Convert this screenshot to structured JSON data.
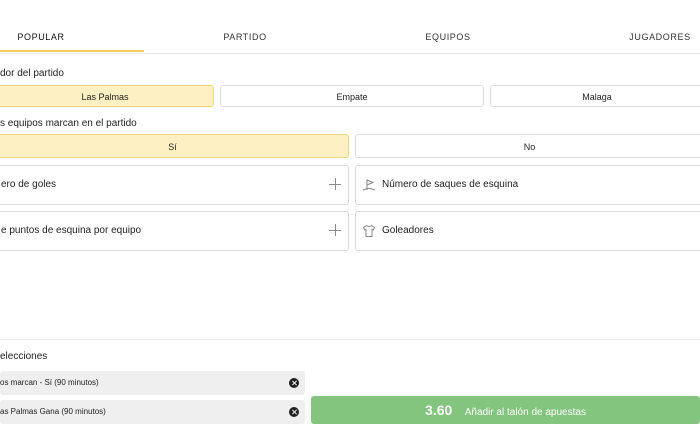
{
  "tabs": [
    {
      "label": "POPULAR",
      "active": true
    },
    {
      "label": "PARTIDO",
      "active": false
    },
    {
      "label": "EQUIPOS",
      "active": false
    },
    {
      "label": "JUGADORES",
      "active": false
    }
  ],
  "markets": {
    "winner": {
      "title": "dor del partido",
      "options": [
        {
          "label": "Las Palmas",
          "selected": true
        },
        {
          "label": "Empate",
          "selected": false
        },
        {
          "label": "Malaga",
          "selected": false
        }
      ]
    },
    "both_score": {
      "title": "s equipos marcan en el partido",
      "options": [
        {
          "label": "Sí",
          "selected": true
        },
        {
          "label": "No",
          "selected": false
        }
      ]
    },
    "collapsed": [
      {
        "label": "ero de goles",
        "icon": "plus-icon"
      },
      {
        "label": "Número de saques de esquina",
        "icon": "corner-flag-icon"
      },
      {
        "label": "e puntos de esquina por equipo",
        "icon": "plus-icon"
      },
      {
        "label": "Goleadores",
        "icon": "jersey-icon"
      }
    ]
  },
  "betslip": {
    "title": "elecciones",
    "selections": [
      {
        "label": "os marcan - Sí (90 minutos)"
      },
      {
        "label": "as Palmas Gana (90 minutos)"
      }
    ],
    "odds": "3.60",
    "cta_label": "Añadir al talón de apuestas"
  },
  "colors": {
    "accent": "#f2cf5a",
    "selected_bg": "#fdf0c2",
    "cta_bg": "#83c57e"
  }
}
